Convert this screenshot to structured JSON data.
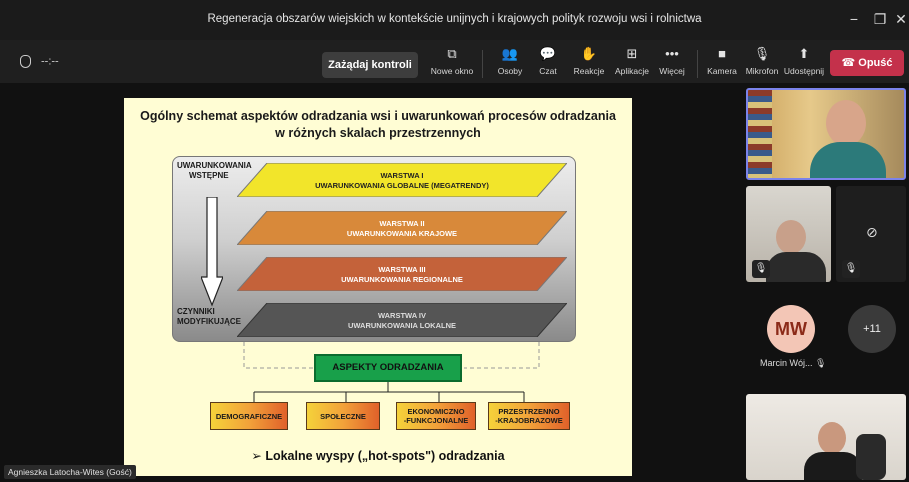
{
  "window": {
    "title": "Regeneracja obszarów wiejskich w kontekście unijnych i krajowych polityk rozwoju wsi i rolnictwa",
    "controls": [
      "−",
      "❐",
      "✕"
    ]
  },
  "toolbar": {
    "timer": "--:--",
    "request_control": "Zażądaj kontroli",
    "items": [
      {
        "label": "Nowe okno",
        "icon": "popout-icon",
        "glyph": "⧉"
      },
      {
        "label": "Osoby",
        "icon": "people-icon",
        "glyph": "👥"
      },
      {
        "label": "Czat",
        "icon": "chat-icon",
        "glyph": "💬"
      },
      {
        "label": "Reakcje",
        "icon": "reactions-icon",
        "glyph": "✋"
      },
      {
        "label": "Aplikacje",
        "icon": "apps-icon",
        "glyph": "⊞"
      },
      {
        "label": "Więcej",
        "icon": "more-icon",
        "glyph": "•••"
      },
      {
        "label": "Kamera",
        "icon": "camera-icon",
        "glyph": "■"
      },
      {
        "label": "Mikrofon",
        "icon": "mic-off-icon",
        "glyph": "🎙"
      },
      {
        "label": "Udostępnij",
        "icon": "share-icon",
        "glyph": "⬆"
      }
    ],
    "leave": "Opuść"
  },
  "slide": {
    "title_line1": "Ogólny schemat aspektów odradzania wsi i uwarunkowań procesów odradzania",
    "title_line2": "w różnych skalach przestrzennych",
    "left_top_line1": "UWARUNKOWANIA",
    "left_top_line2": "WSTĘPNE",
    "left_bottom_line1": "CZYNNIKI",
    "left_bottom_line2": "MODYFIKUJĄCE",
    "layers": [
      {
        "line1": "WARSTWA I",
        "line2": "UWARUNKOWANIA GLOBALNE (MEGATRENDY)",
        "color": "#f2e52a"
      },
      {
        "line1": "WARSTWA II",
        "line2": "UWARUNKOWANIA KRAJOWE",
        "color": "#d8893a"
      },
      {
        "line1": "WARSTWA III",
        "line2": "UWARUNKOWANIA REGIONALNE",
        "color": "#c4623a"
      },
      {
        "line1": "WARSTWA IV",
        "line2": "UWARUNKOWANIA LOKALNE",
        "color": "#555555"
      }
    ],
    "aspects_title": "ASPEKTY ODRADZANIA",
    "aspects": [
      {
        "line1": "DEMOGRAFICZNE",
        "line2": ""
      },
      {
        "line1": "SPOŁECZNE",
        "line2": ""
      },
      {
        "line1": "EKONOMICZNO",
        "line2": "-FUNKCJONALNE"
      },
      {
        "line1": "PRZESTRZENNO",
        "line2": "-KRAJOBRAZOWE"
      }
    ],
    "footer": "➢ Lokalne wyspy („hot-spots\") odradzania"
  },
  "presenter_tag": "Agnieszka Latocha-Wites (Gość)",
  "participants": {
    "avatar_initials": "MW",
    "avatar_name": "Marcin Wój...",
    "more_count": "+11"
  }
}
